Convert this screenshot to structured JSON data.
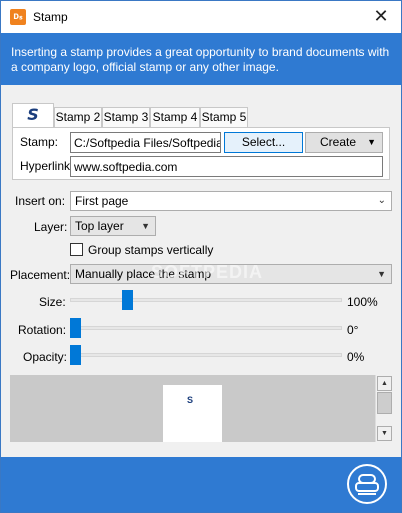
{
  "window": {
    "title": "Stamp",
    "app_icon_glyph": "ᴅₛ",
    "close_glyph": "✕",
    "accent_color": "#2f7ad2"
  },
  "banner": {
    "text": "Inserting a stamp provides a great opportunity to brand documents with a company logo, official stamp or any other image."
  },
  "tabs": [
    {
      "label": "S",
      "icon": "softpedia-logo-icon",
      "active": true
    },
    {
      "label": "Stamp 2"
    },
    {
      "label": "Stamp 3"
    },
    {
      "label": "Stamp 4"
    },
    {
      "label": "Stamp 5"
    }
  ],
  "stamp_panel": {
    "stamp_label": "Stamp:",
    "stamp_value": "C:/Softpedia Files/Softpedia te",
    "select_label": "Select...",
    "create_label": "Create",
    "hyperlink_label": "Hyperlink",
    "hyperlink_value": "www.softpedia.com"
  },
  "options": {
    "insert_on_label": "Insert on:",
    "insert_on_value": "First page",
    "layer_label": "Layer:",
    "layer_value": "Top layer",
    "group_label": "Group stamps vertically",
    "group_checked": false,
    "placement_label": "Placement:",
    "placement_value": "Manually place the stamp",
    "size_label": "Size:",
    "size_value": "100%",
    "size_level": 0.2,
    "rotation_label": "Rotation:",
    "rotation_value": "0°",
    "rotation_level": 0.0,
    "opacity_label": "Opacity:",
    "opacity_value": "0%",
    "opacity_level": 0.0
  },
  "watermark_text": "SOFTPEDIA",
  "preview": {
    "stamp_glyph": "S"
  }
}
